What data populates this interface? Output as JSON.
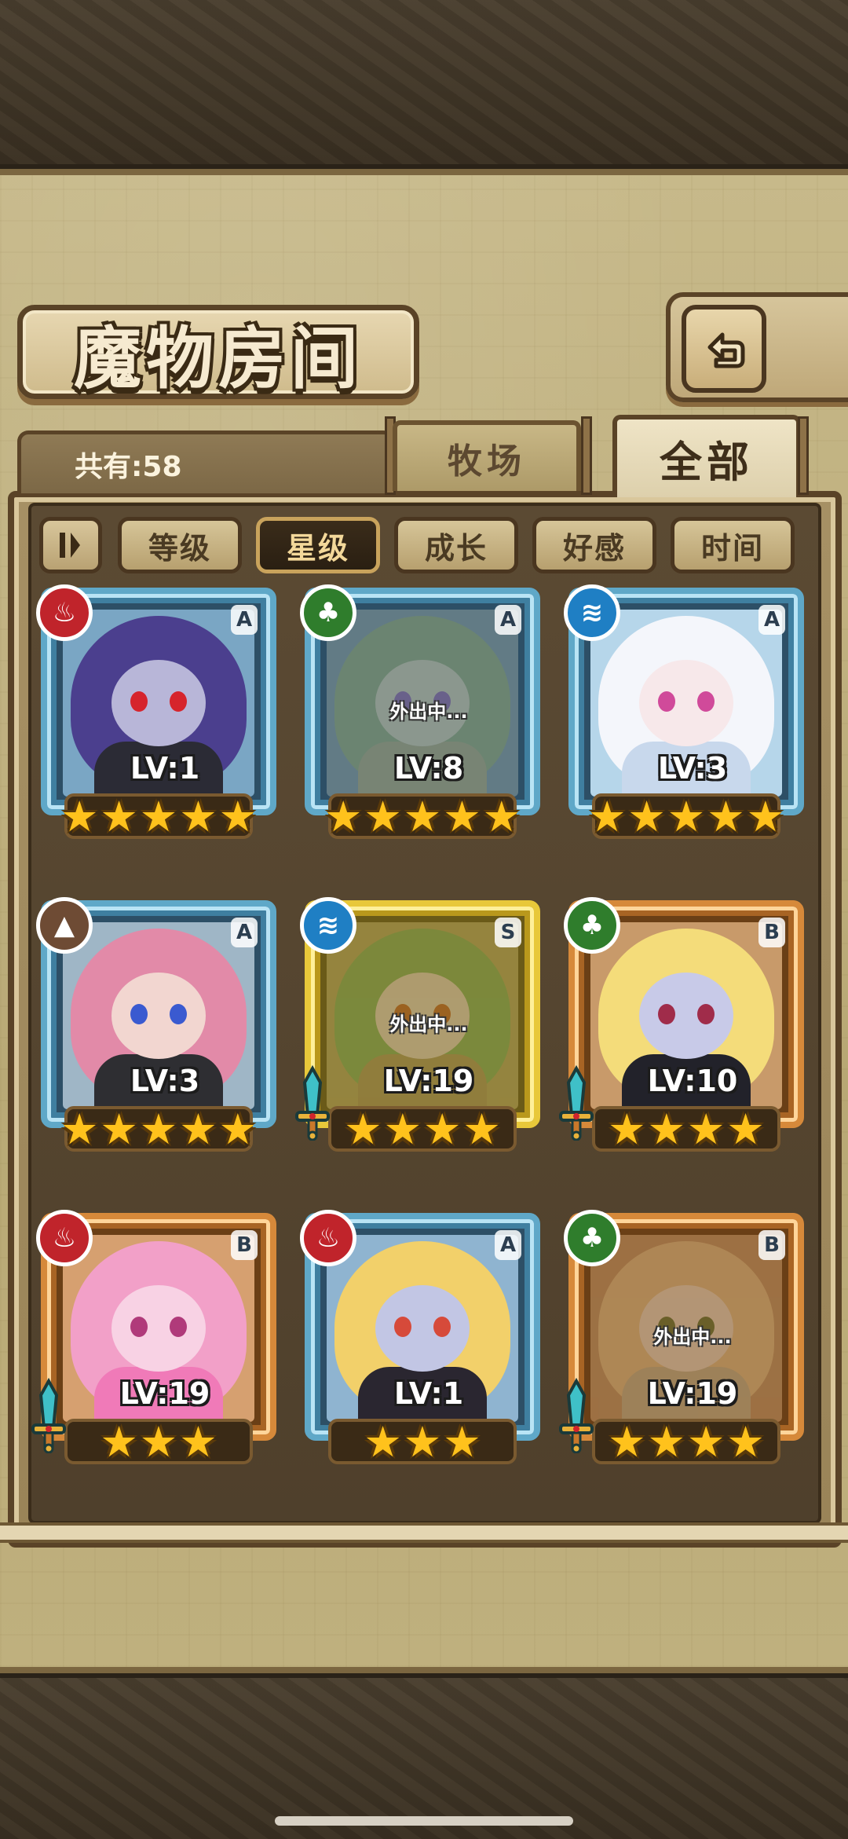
{
  "title": "魔物房间",
  "count_label": "共有:58",
  "tabs": [
    {
      "label": "牧场",
      "active": false
    },
    {
      "label": "全部",
      "active": true
    }
  ],
  "sort_buttons": [
    {
      "label": "等级",
      "active": false
    },
    {
      "label": "星级",
      "active": true
    },
    {
      "label": "成长",
      "active": false
    },
    {
      "label": "好感",
      "active": false
    },
    {
      "label": "时间",
      "active": false
    }
  ],
  "away_text": "外出中...",
  "monsters": [
    {
      "level": "LV:1",
      "rank": "A",
      "element": "fire",
      "stars": 5,
      "away": false,
      "weapon": false
    },
    {
      "level": "LV:8",
      "rank": "A",
      "element": "leaf",
      "stars": 5,
      "away": true,
      "weapon": false
    },
    {
      "level": "LV:3",
      "rank": "A",
      "element": "water",
      "stars": 5,
      "away": false,
      "weapon": false
    },
    {
      "level": "LV:3",
      "rank": "A",
      "element": "earth",
      "stars": 5,
      "away": false,
      "weapon": false
    },
    {
      "level": "LV:19",
      "rank": "S",
      "element": "water",
      "stars": 4,
      "away": true,
      "weapon": true
    },
    {
      "level": "LV:10",
      "rank": "B",
      "element": "leaf",
      "stars": 4,
      "away": false,
      "weapon": true
    },
    {
      "level": "LV:19",
      "rank": "B",
      "element": "fire",
      "stars": 3,
      "away": false,
      "weapon": true
    },
    {
      "level": "LV:1",
      "rank": "A",
      "element": "fire",
      "stars": 3,
      "away": false,
      "weapon": false
    },
    {
      "level": "LV:19",
      "rank": "B",
      "element": "leaf",
      "stars": 4,
      "away": true,
      "weapon": true
    }
  ],
  "colors": {
    "rank_A": "#5fa8c8",
    "rank_S": "#e8c83a",
    "rank_B": "#d6893a",
    "star": "#ffc21c"
  }
}
